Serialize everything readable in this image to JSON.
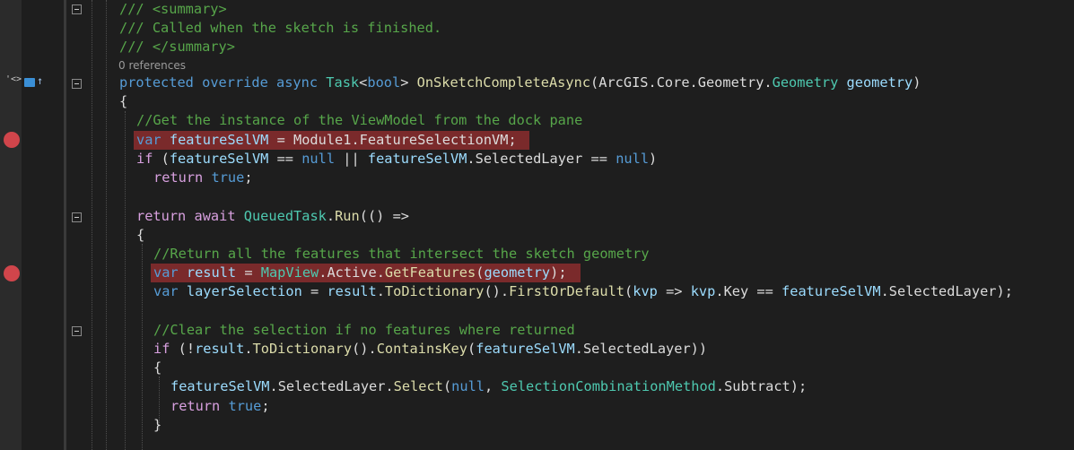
{
  "editor": {
    "codelens": "0 references",
    "glyphs": {
      "override_marker": "'<>",
      "override_arrow": "↑"
    },
    "colors": {
      "background": "#1e1e1e",
      "comment": "#57a64a",
      "keyword": "#569cd6",
      "control_keyword": "#d8a0df",
      "type": "#4ec9b0",
      "method": "#dcdcaa",
      "parameter": "#9cdcfe",
      "breakpoint": "#d0454b",
      "breakpoint_highlight": "#7a2a2b"
    },
    "lines": [
      {
        "indent": 0,
        "tokens": [
          [
            "dc",
            "/// <summary>"
          ]
        ]
      },
      {
        "indent": 0,
        "tokens": [
          [
            "dc",
            "/// Called when the sketch is finished."
          ]
        ]
      },
      {
        "indent": 0,
        "tokens": [
          [
            "dc",
            "/// </summary>"
          ]
        ]
      },
      {
        "indent": 0,
        "tokens": [
          [
            "kw",
            "protected"
          ],
          [
            "tx",
            " "
          ],
          [
            "kw",
            "override"
          ],
          [
            "tx",
            " "
          ],
          [
            "kw",
            "async"
          ],
          [
            "tx",
            " "
          ],
          [
            "ty",
            "Task"
          ],
          [
            "tx",
            "<"
          ],
          [
            "kw",
            "bool"
          ],
          [
            "tx",
            "> "
          ],
          [
            "me",
            "OnSketchCompleteAsync"
          ],
          [
            "tx",
            "(ArcGIS.Core.Geometry."
          ],
          [
            "ty",
            "Geometry"
          ],
          [
            "tx",
            " "
          ],
          [
            "pa",
            "geometry"
          ],
          [
            "tx",
            ")"
          ]
        ]
      },
      {
        "indent": 0,
        "tokens": [
          [
            "tx",
            "{"
          ]
        ]
      },
      {
        "indent": 1,
        "tokens": [
          [
            "cm",
            "//Get the instance of the ViewModel from the dock pane"
          ]
        ]
      },
      {
        "indent": 1,
        "tokens": [
          [
            "kw",
            "var"
          ],
          [
            "tx",
            " "
          ],
          [
            "pa",
            "featureSelVM"
          ],
          [
            "tx",
            " = Module1.FeatureSelectionVM;"
          ]
        ]
      },
      {
        "indent": 1,
        "tokens": [
          [
            "kw2",
            "if"
          ],
          [
            "tx",
            " ("
          ],
          [
            "pa",
            "featureSelVM"
          ],
          [
            "tx",
            " == "
          ],
          [
            "kw",
            "null"
          ],
          [
            "tx",
            " || "
          ],
          [
            "pa",
            "featureSelVM"
          ],
          [
            "tx",
            ".SelectedLayer == "
          ],
          [
            "kw",
            "null"
          ],
          [
            "tx",
            ")"
          ]
        ]
      },
      {
        "indent": 2,
        "tokens": [
          [
            "kw2",
            "return"
          ],
          [
            "tx",
            " "
          ],
          [
            "kw",
            "true"
          ],
          [
            "tx",
            ";"
          ]
        ]
      },
      {
        "indent": 0,
        "tokens": []
      },
      {
        "indent": 1,
        "tokens": [
          [
            "kw2",
            "return"
          ],
          [
            "tx",
            " "
          ],
          [
            "kw2",
            "await"
          ],
          [
            "tx",
            " "
          ],
          [
            "ty",
            "QueuedTask"
          ],
          [
            "tx",
            "."
          ],
          [
            "me",
            "Run"
          ],
          [
            "tx",
            "(() =>"
          ]
        ]
      },
      {
        "indent": 1,
        "tokens": [
          [
            "tx",
            "{"
          ]
        ]
      },
      {
        "indent": 2,
        "tokens": [
          [
            "cm",
            "//Return all the features that intersect the sketch geometry"
          ]
        ]
      },
      {
        "indent": 2,
        "tokens": [
          [
            "kw",
            "var"
          ],
          [
            "tx",
            " "
          ],
          [
            "pa",
            "result"
          ],
          [
            "tx",
            " = "
          ],
          [
            "ty",
            "MapView"
          ],
          [
            "tx",
            ".Active."
          ],
          [
            "me",
            "GetFeatures"
          ],
          [
            "tx",
            "("
          ],
          [
            "pa",
            "geometry"
          ],
          [
            "tx",
            ");"
          ]
        ]
      },
      {
        "indent": 2,
        "tokens": [
          [
            "kw",
            "var"
          ],
          [
            "tx",
            " "
          ],
          [
            "pa",
            "layerSelection"
          ],
          [
            "tx",
            " = "
          ],
          [
            "pa",
            "result"
          ],
          [
            "tx",
            "."
          ],
          [
            "me",
            "ToDictionary"
          ],
          [
            "tx",
            "()."
          ],
          [
            "me",
            "FirstOrDefault"
          ],
          [
            "tx",
            "("
          ],
          [
            "pa",
            "kvp"
          ],
          [
            "tx",
            " => "
          ],
          [
            "pa",
            "kvp"
          ],
          [
            "tx",
            ".Key == "
          ],
          [
            "pa",
            "featureSelVM"
          ],
          [
            "tx",
            ".SelectedLayer);"
          ]
        ]
      },
      {
        "indent": 0,
        "tokens": []
      },
      {
        "indent": 2,
        "tokens": [
          [
            "cm",
            "//Clear the selection if no features where returned"
          ]
        ]
      },
      {
        "indent": 2,
        "tokens": [
          [
            "kw2",
            "if"
          ],
          [
            "tx",
            " (!"
          ],
          [
            "pa",
            "result"
          ],
          [
            "tx",
            "."
          ],
          [
            "me",
            "ToDictionary"
          ],
          [
            "tx",
            "()."
          ],
          [
            "me",
            "ContainsKey"
          ],
          [
            "tx",
            "("
          ],
          [
            "pa",
            "featureSelVM"
          ],
          [
            "tx",
            ".SelectedLayer))"
          ]
        ]
      },
      {
        "indent": 2,
        "tokens": [
          [
            "tx",
            "{"
          ]
        ]
      },
      {
        "indent": 3,
        "tokens": [
          [
            "pa",
            "featureSelVM"
          ],
          [
            "tx",
            ".SelectedLayer."
          ],
          [
            "me",
            "Select"
          ],
          [
            "tx",
            "("
          ],
          [
            "kw",
            "null"
          ],
          [
            "tx",
            ", "
          ],
          [
            "ty",
            "SelectionCombinationMethod"
          ],
          [
            "tx",
            ".Subtract);"
          ]
        ]
      },
      {
        "indent": 3,
        "tokens": [
          [
            "kw2",
            "return"
          ],
          [
            "tx",
            " "
          ],
          [
            "kw",
            "true"
          ],
          [
            "tx",
            ";"
          ]
        ]
      },
      {
        "indent": 2,
        "tokens": [
          [
            "tx",
            "}"
          ]
        ]
      }
    ]
  }
}
